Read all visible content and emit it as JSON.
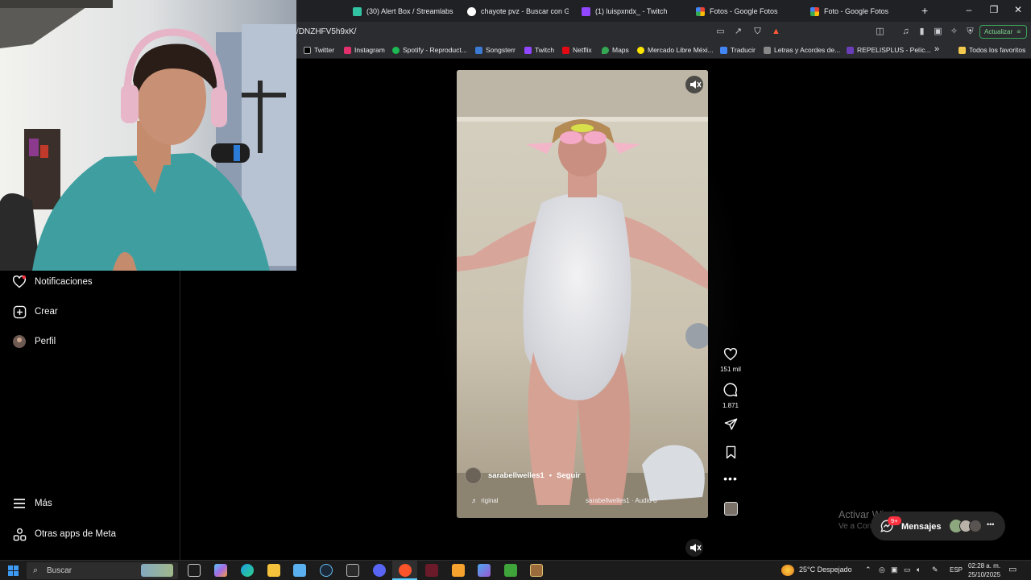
{
  "browser": {
    "tabs": [
      {
        "title": "(30) Alert Box / Streamlabs",
        "color": "#31c3a2"
      },
      {
        "title": "chayote pvz - Buscar con Goog",
        "color": "#ffffff"
      },
      {
        "title": "(1) luispxndx_ - Twitch",
        "color": "#9146ff"
      },
      {
        "title": "Fotos - Google Fotos",
        "color": "#fbbc05"
      },
      {
        "title": "Foto - Google Fotos",
        "color": "#fbbc05"
      }
    ],
    "new_tab": "+",
    "url": "/DNZHFV5h9xK/",
    "update_label": "Actualizar",
    "bookmarks": [
      {
        "label": "Twitter",
        "color": "#000000"
      },
      {
        "label": "Instagram",
        "color": "#e1306c"
      },
      {
        "label": "Spotify - Reproduct...",
        "color": "#1db954"
      },
      {
        "label": "Songsterr",
        "color": "#3b7bd4"
      },
      {
        "label": "Twitch",
        "color": "#9146ff"
      },
      {
        "label": "Netflix",
        "color": "#e50914"
      },
      {
        "label": "Maps",
        "color": "#34a853"
      },
      {
        "label": "Mercado Libre Méxi...",
        "color": "#ffe600"
      },
      {
        "label": "Traducir",
        "color": "#4285f4"
      },
      {
        "label": "Letras y Acordes de...",
        "color": "#888888"
      },
      {
        "label": "REPELISPLUS - Pelíc...",
        "color": "#6a3db8"
      }
    ],
    "bookmarks_overflow": "»",
    "all_favorites": "Todos los favoritos"
  },
  "sidebar": {
    "items": [
      {
        "label": "Notificaciones",
        "icon": "heart-icon"
      },
      {
        "label": "Crear",
        "icon": "plus-square-icon"
      },
      {
        "label": "Perfil",
        "icon": "avatar"
      },
      {
        "label": "Más",
        "icon": "menu-icon"
      },
      {
        "label": "Otras apps de Meta",
        "icon": "meta-apps-icon"
      }
    ]
  },
  "reel": {
    "username": "sarabellwelles1",
    "separator": "•",
    "follow": "Seguir",
    "audio_left": "riginal",
    "audio_right": "sarabellwelles1 · Audio or",
    "likes": "151 mil",
    "comments": "1.871"
  },
  "messages": {
    "label": "Mensajes",
    "badge": "9+"
  },
  "watermark": {
    "title": "Activar Windows",
    "subtitle": "Ve a Configuración para activar Windows."
  },
  "taskbar": {
    "search_placeholder": "Buscar",
    "weather": "25°C  Despejado",
    "language": "ESP",
    "time": "02:28 a. m.",
    "date": "25/10/2025"
  }
}
